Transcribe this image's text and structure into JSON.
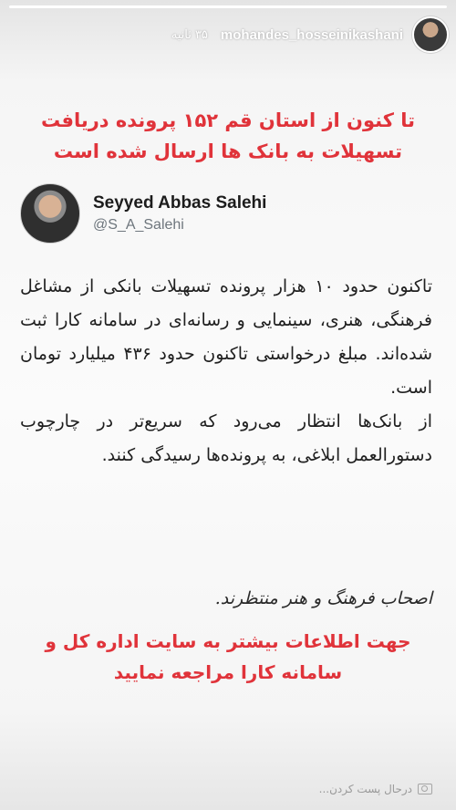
{
  "story": {
    "progress": 1.0,
    "username": "mohandes_hosseinikashani",
    "time": "۳۵ ثانیه"
  },
  "headline": {
    "line1": "تا کنون از استان قم ۱۵۲ پرونده دریافت",
    "line2": "تسهیلات به بانک ها ارسال شده است"
  },
  "tweet": {
    "author_name": "Seyyed Abbas Salehi",
    "author_handle": "@S_A_Salehi",
    "paragraph1": "تاکنون حدود ۱۰ هزار پرونده تسهیلات بانکی از مشاغل فرهنگی، هنری، سینمایی و رسانه‌ای در سامانه کارا ثبت شده‌اند. مبلغ درخواستی تاکنون حدود ۴۳۶ میلیارد تومان است.",
    "paragraph2": "از بانک‌ها انتظار می‌رود که سریع‌تر در چارچوب دستورالعمل ابلاغی، به پرونده‌ها رسیدگی کنند.",
    "signature": "اصحاب فرهنگ و هنر منتظرند."
  },
  "footer_note": {
    "line1": "جهت اطلاعات بیشتر به سایت اداره کل و",
    "line2": "سامانه کارا مراجعه نمایید"
  },
  "bottom": {
    "reply_placeholder": "درحال پست کردن..."
  }
}
